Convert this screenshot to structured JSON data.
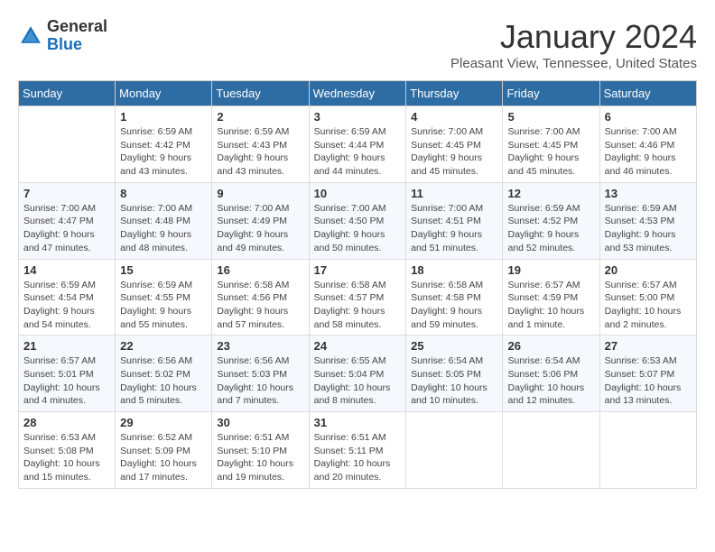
{
  "header": {
    "logo_line1": "General",
    "logo_line2": "Blue",
    "month_title": "January 2024",
    "location": "Pleasant View, Tennessee, United States"
  },
  "weekdays": [
    "Sunday",
    "Monday",
    "Tuesday",
    "Wednesday",
    "Thursday",
    "Friday",
    "Saturday"
  ],
  "weeks": [
    [
      {
        "day": "",
        "sunrise": "",
        "sunset": "",
        "daylight": ""
      },
      {
        "day": "1",
        "sunrise": "Sunrise: 6:59 AM",
        "sunset": "Sunset: 4:42 PM",
        "daylight": "Daylight: 9 hours and 43 minutes."
      },
      {
        "day": "2",
        "sunrise": "Sunrise: 6:59 AM",
        "sunset": "Sunset: 4:43 PM",
        "daylight": "Daylight: 9 hours and 43 minutes."
      },
      {
        "day": "3",
        "sunrise": "Sunrise: 6:59 AM",
        "sunset": "Sunset: 4:44 PM",
        "daylight": "Daylight: 9 hours and 44 minutes."
      },
      {
        "day": "4",
        "sunrise": "Sunrise: 7:00 AM",
        "sunset": "Sunset: 4:45 PM",
        "daylight": "Daylight: 9 hours and 45 minutes."
      },
      {
        "day": "5",
        "sunrise": "Sunrise: 7:00 AM",
        "sunset": "Sunset: 4:45 PM",
        "daylight": "Daylight: 9 hours and 45 minutes."
      },
      {
        "day": "6",
        "sunrise": "Sunrise: 7:00 AM",
        "sunset": "Sunset: 4:46 PM",
        "daylight": "Daylight: 9 hours and 46 minutes."
      }
    ],
    [
      {
        "day": "7",
        "sunrise": "Sunrise: 7:00 AM",
        "sunset": "Sunset: 4:47 PM",
        "daylight": "Daylight: 9 hours and 47 minutes."
      },
      {
        "day": "8",
        "sunrise": "Sunrise: 7:00 AM",
        "sunset": "Sunset: 4:48 PM",
        "daylight": "Daylight: 9 hours and 48 minutes."
      },
      {
        "day": "9",
        "sunrise": "Sunrise: 7:00 AM",
        "sunset": "Sunset: 4:49 PM",
        "daylight": "Daylight: 9 hours and 49 minutes."
      },
      {
        "day": "10",
        "sunrise": "Sunrise: 7:00 AM",
        "sunset": "Sunset: 4:50 PM",
        "daylight": "Daylight: 9 hours and 50 minutes."
      },
      {
        "day": "11",
        "sunrise": "Sunrise: 7:00 AM",
        "sunset": "Sunset: 4:51 PM",
        "daylight": "Daylight: 9 hours and 51 minutes."
      },
      {
        "day": "12",
        "sunrise": "Sunrise: 6:59 AM",
        "sunset": "Sunset: 4:52 PM",
        "daylight": "Daylight: 9 hours and 52 minutes."
      },
      {
        "day": "13",
        "sunrise": "Sunrise: 6:59 AM",
        "sunset": "Sunset: 4:53 PM",
        "daylight": "Daylight: 9 hours and 53 minutes."
      }
    ],
    [
      {
        "day": "14",
        "sunrise": "Sunrise: 6:59 AM",
        "sunset": "Sunset: 4:54 PM",
        "daylight": "Daylight: 9 hours and 54 minutes."
      },
      {
        "day": "15",
        "sunrise": "Sunrise: 6:59 AM",
        "sunset": "Sunset: 4:55 PM",
        "daylight": "Daylight: 9 hours and 55 minutes."
      },
      {
        "day": "16",
        "sunrise": "Sunrise: 6:58 AM",
        "sunset": "Sunset: 4:56 PM",
        "daylight": "Daylight: 9 hours and 57 minutes."
      },
      {
        "day": "17",
        "sunrise": "Sunrise: 6:58 AM",
        "sunset": "Sunset: 4:57 PM",
        "daylight": "Daylight: 9 hours and 58 minutes."
      },
      {
        "day": "18",
        "sunrise": "Sunrise: 6:58 AM",
        "sunset": "Sunset: 4:58 PM",
        "daylight": "Daylight: 9 hours and 59 minutes."
      },
      {
        "day": "19",
        "sunrise": "Sunrise: 6:57 AM",
        "sunset": "Sunset: 4:59 PM",
        "daylight": "Daylight: 10 hours and 1 minute."
      },
      {
        "day": "20",
        "sunrise": "Sunrise: 6:57 AM",
        "sunset": "Sunset: 5:00 PM",
        "daylight": "Daylight: 10 hours and 2 minutes."
      }
    ],
    [
      {
        "day": "21",
        "sunrise": "Sunrise: 6:57 AM",
        "sunset": "Sunset: 5:01 PM",
        "daylight": "Daylight: 10 hours and 4 minutes."
      },
      {
        "day": "22",
        "sunrise": "Sunrise: 6:56 AM",
        "sunset": "Sunset: 5:02 PM",
        "daylight": "Daylight: 10 hours and 5 minutes."
      },
      {
        "day": "23",
        "sunrise": "Sunrise: 6:56 AM",
        "sunset": "Sunset: 5:03 PM",
        "daylight": "Daylight: 10 hours and 7 minutes."
      },
      {
        "day": "24",
        "sunrise": "Sunrise: 6:55 AM",
        "sunset": "Sunset: 5:04 PM",
        "daylight": "Daylight: 10 hours and 8 minutes."
      },
      {
        "day": "25",
        "sunrise": "Sunrise: 6:54 AM",
        "sunset": "Sunset: 5:05 PM",
        "daylight": "Daylight: 10 hours and 10 minutes."
      },
      {
        "day": "26",
        "sunrise": "Sunrise: 6:54 AM",
        "sunset": "Sunset: 5:06 PM",
        "daylight": "Daylight: 10 hours and 12 minutes."
      },
      {
        "day": "27",
        "sunrise": "Sunrise: 6:53 AM",
        "sunset": "Sunset: 5:07 PM",
        "daylight": "Daylight: 10 hours and 13 minutes."
      }
    ],
    [
      {
        "day": "28",
        "sunrise": "Sunrise: 6:53 AM",
        "sunset": "Sunset: 5:08 PM",
        "daylight": "Daylight: 10 hours and 15 minutes."
      },
      {
        "day": "29",
        "sunrise": "Sunrise: 6:52 AM",
        "sunset": "Sunset: 5:09 PM",
        "daylight": "Daylight: 10 hours and 17 minutes."
      },
      {
        "day": "30",
        "sunrise": "Sunrise: 6:51 AM",
        "sunset": "Sunset: 5:10 PM",
        "daylight": "Daylight: 10 hours and 19 minutes."
      },
      {
        "day": "31",
        "sunrise": "Sunrise: 6:51 AM",
        "sunset": "Sunset: 5:11 PM",
        "daylight": "Daylight: 10 hours and 20 minutes."
      },
      {
        "day": "",
        "sunrise": "",
        "sunset": "",
        "daylight": ""
      },
      {
        "day": "",
        "sunrise": "",
        "sunset": "",
        "daylight": ""
      },
      {
        "day": "",
        "sunrise": "",
        "sunset": "",
        "daylight": ""
      }
    ]
  ]
}
